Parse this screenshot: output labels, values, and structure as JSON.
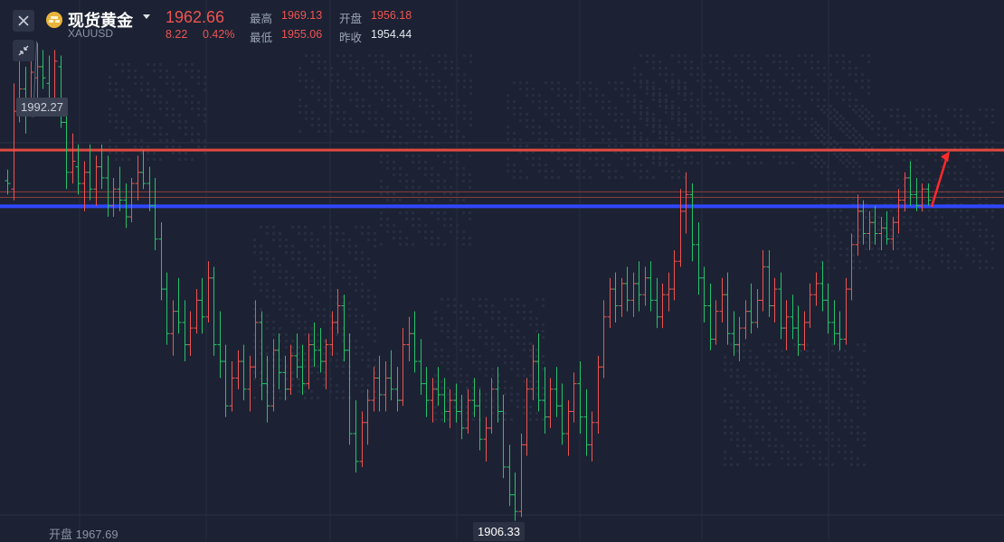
{
  "header": {
    "name": "现货黄金",
    "symbol": "XAUUSD",
    "price": "1962.66",
    "change": "8.22",
    "change_pct": "0.42%",
    "high_label": "最高",
    "high": "1969.13",
    "open_label": "开盘",
    "open": "1956.18",
    "low_label": "最低",
    "low": "1955.06",
    "prev_close_label": "昨收",
    "prev_close": "1954.44"
  },
  "annotations": {
    "max_label": "1992.27",
    "min_label": "1906.33",
    "open_marker": "开盘 1967.69"
  },
  "icons": {
    "close": "close-icon",
    "minimize": "collapse-icon",
    "coin": "gold-coin-icon"
  },
  "colors": {
    "background": "#1c2233",
    "up": "#ef5350",
    "down": "#26c26b",
    "resistance_line": "#e0493f",
    "support_line": "#2f47ff",
    "arrow": "#ff2a2a",
    "text_label": "#9aa3b5"
  },
  "chart_data": {
    "type": "bar",
    "title": "",
    "style": "ohlc-bars",
    "ylim": [
      1903,
      2000
    ],
    "grid": true,
    "horizontal_lines": [
      {
        "kind": "resistance",
        "value": 1973.0
      },
      {
        "kind": "level",
        "value": 1965.5
      },
      {
        "kind": "level",
        "value": 1964.5
      },
      {
        "kind": "support",
        "value": 1962.9
      }
    ],
    "max_marker": 1992.27,
    "min_marker": 1906.33,
    "arrow": {
      "from": 1962.8,
      "to": 1972.8
    },
    "bars": [
      [
        1967.5,
        1969.5,
        1965,
        1967
      ],
      [
        1966,
        1985,
        1964,
        1980
      ],
      [
        1980,
        1990,
        1978,
        1984
      ],
      [
        1984,
        1988,
        1976,
        1980
      ],
      [
        1980,
        1990,
        1979,
        1987
      ],
      [
        1986,
        1992.27,
        1982,
        1988
      ],
      [
        1988,
        1991,
        1984,
        1986
      ],
      [
        1985,
        1990,
        1980,
        1982
      ],
      [
        1982,
        1991,
        1981,
        1989
      ],
      [
        1988,
        1990,
        1977,
        1978
      ],
      [
        1978,
        1982,
        1966,
        1969
      ],
      [
        1969,
        1976,
        1967,
        1971
      ],
      [
        1970,
        1974,
        1965,
        1967
      ],
      [
        1967,
        1971,
        1962,
        1969
      ],
      [
        1969,
        1974,
        1964,
        1966
      ],
      [
        1966,
        1972,
        1963,
        1970
      ],
      [
        1970,
        1974,
        1966,
        1968
      ],
      [
        1968,
        1972,
        1961,
        1963
      ],
      [
        1963,
        1968,
        1961,
        1966
      ],
      [
        1966,
        1970,
        1962,
        1964
      ],
      [
        1964,
        1967,
        1959,
        1961
      ],
      [
        1961,
        1968,
        1960,
        1967
      ],
      [
        1967,
        1972,
        1964,
        1969
      ],
      [
        1969,
        1973,
        1966,
        1967
      ],
      [
        1967,
        1970,
        1962,
        1963
      ],
      [
        1963,
        1968,
        1955,
        1957
      ],
      [
        1957,
        1960,
        1946,
        1948
      ],
      [
        1948,
        1951,
        1938,
        1940
      ],
      [
        1940,
        1946,
        1936,
        1944
      ],
      [
        1944,
        1950,
        1940,
        1942
      ],
      [
        1942,
        1946,
        1935,
        1938
      ],
      [
        1938,
        1944,
        1936,
        1941
      ],
      [
        1941,
        1948,
        1940,
        1946
      ],
      [
        1946,
        1950,
        1940,
        1943
      ],
      [
        1943,
        1953,
        1942,
        1950
      ],
      [
        1950,
        1952,
        1936,
        1938
      ],
      [
        1938,
        1944,
        1932,
        1935
      ],
      [
        1935,
        1938,
        1925,
        1927
      ],
      [
        1927,
        1935,
        1926,
        1932
      ],
      [
        1932,
        1937,
        1930,
        1935
      ],
      [
        1935,
        1938,
        1928,
        1930
      ],
      [
        1930,
        1936,
        1926,
        1934
      ],
      [
        1934,
        1946,
        1932,
        1942
      ],
      [
        1942,
        1944,
        1928,
        1931
      ],
      [
        1931,
        1936,
        1924,
        1927
      ],
      [
        1927,
        1939,
        1926,
        1937
      ],
      [
        1937,
        1940,
        1930,
        1933
      ],
      [
        1933,
        1936,
        1928,
        1930
      ],
      [
        1930,
        1938,
        1929,
        1936
      ],
      [
        1936,
        1940,
        1932,
        1934
      ],
      [
        1934,
        1938,
        1929,
        1931
      ],
      [
        1931,
        1940,
        1930,
        1938
      ],
      [
        1938,
        1942,
        1934,
        1937
      ],
      [
        1937,
        1941,
        1933,
        1935
      ],
      [
        1935,
        1939,
        1930,
        1938
      ],
      [
        1938,
        1944,
        1936,
        1942
      ],
      [
        1942,
        1948,
        1940,
        1945
      ],
      [
        1945,
        1947,
        1935,
        1937
      ],
      [
        1937,
        1940,
        1920,
        1922
      ],
      [
        1922,
        1928,
        1915,
        1917
      ],
      [
        1917,
        1926,
        1916,
        1924
      ],
      [
        1924,
        1930,
        1920,
        1928
      ],
      [
        1928,
        1934,
        1926,
        1932
      ],
      [
        1932,
        1936,
        1926,
        1929
      ],
      [
        1929,
        1935,
        1926,
        1932
      ],
      [
        1932,
        1937,
        1928,
        1930
      ],
      [
        1930,
        1934,
        1926,
        1928
      ],
      [
        1928,
        1941,
        1927,
        1938
      ],
      [
        1938,
        1943,
        1935,
        1940
      ],
      [
        1940,
        1944,
        1933,
        1935
      ],
      [
        1935,
        1939,
        1929,
        1931
      ],
      [
        1931,
        1934,
        1925,
        1928
      ],
      [
        1928,
        1932,
        1924,
        1930
      ],
      [
        1930,
        1934,
        1927,
        1929
      ],
      [
        1929,
        1932,
        1924,
        1926
      ],
      [
        1926,
        1930,
        1923,
        1928
      ],
      [
        1928,
        1931,
        1924,
        1926
      ],
      [
        1926,
        1929,
        1921,
        1923
      ],
      [
        1923,
        1930,
        1922,
        1928
      ],
      [
        1928,
        1932,
        1925,
        1927
      ],
      [
        1927,
        1930,
        1919,
        1921
      ],
      [
        1921,
        1925,
        1917,
        1923
      ],
      [
        1923,
        1932,
        1922,
        1930
      ],
      [
        1930,
        1934,
        1924,
        1926
      ],
      [
        1926,
        1929,
        1914,
        1916
      ],
      [
        1916,
        1920,
        1909,
        1911
      ],
      [
        1911,
        1915,
        1906.33,
        1908
      ],
      [
        1908,
        1922,
        1907,
        1920
      ],
      [
        1920,
        1932,
        1918,
        1930
      ],
      [
        1930,
        1938,
        1928,
        1935
      ],
      [
        1935,
        1940,
        1926,
        1928
      ],
      [
        1928,
        1934,
        1922,
        1925
      ],
      [
        1925,
        1932,
        1923,
        1930
      ],
      [
        1930,
        1934,
        1925,
        1927
      ],
      [
        1927,
        1931,
        1920,
        1922
      ],
      [
        1922,
        1928,
        1918,
        1926
      ],
      [
        1926,
        1933,
        1924,
        1931
      ],
      [
        1931,
        1935,
        1922,
        1925
      ],
      [
        1925,
        1930,
        1918,
        1920
      ],
      [
        1920,
        1926,
        1917,
        1924
      ],
      [
        1924,
        1936,
        1922,
        1934
      ],
      [
        1934,
        1946,
        1932,
        1943
      ],
      [
        1943,
        1950,
        1941,
        1948
      ],
      [
        1948,
        1951,
        1942,
        1945
      ],
      [
        1945,
        1950,
        1943,
        1949
      ],
      [
        1949,
        1952,
        1944,
        1946
      ],
      [
        1946,
        1951,
        1943,
        1949
      ],
      [
        1949,
        1953,
        1944,
        1947
      ],
      [
        1947,
        1952,
        1945,
        1950
      ],
      [
        1950,
        1953,
        1944,
        1946
      ],
      [
        1946,
        1950,
        1941,
        1943
      ],
      [
        1943,
        1949,
        1941,
        1947
      ],
      [
        1947,
        1951,
        1944,
        1948
      ],
      [
        1948,
        1955,
        1946,
        1953
      ],
      [
        1953,
        1966,
        1952,
        1962
      ],
      [
        1962,
        1969,
        1958,
        1965
      ],
      [
        1965,
        1967,
        1953,
        1956
      ],
      [
        1956,
        1960,
        1947,
        1950
      ],
      [
        1950,
        1952,
        1942,
        1945
      ],
      [
        1945,
        1949,
        1937,
        1939
      ],
      [
        1939,
        1946,
        1938,
        1944
      ],
      [
        1944,
        1950,
        1942,
        1947
      ],
      [
        1947,
        1951,
        1938,
        1940
      ],
      [
        1940,
        1944,
        1936,
        1938
      ],
      [
        1938,
        1943,
        1935,
        1941
      ],
      [
        1941,
        1946,
        1939,
        1944
      ],
      [
        1944,
        1949,
        1940,
        1942
      ],
      [
        1942,
        1948,
        1941,
        1946
      ],
      [
        1946,
        1955,
        1944,
        1952
      ],
      [
        1952,
        1955,
        1943,
        1945
      ],
      [
        1945,
        1950,
        1942,
        1948
      ],
      [
        1948,
        1951,
        1939,
        1941
      ],
      [
        1941,
        1946,
        1937,
        1943
      ],
      [
        1943,
        1947,
        1939,
        1941
      ],
      [
        1941,
        1945,
        1936,
        1938
      ],
      [
        1938,
        1944,
        1937,
        1942
      ],
      [
        1942,
        1949,
        1941,
        1947
      ],
      [
        1947,
        1951,
        1945,
        1949
      ],
      [
        1949,
        1953,
        1944,
        1946
      ],
      [
        1946,
        1949,
        1940,
        1942
      ],
      [
        1942,
        1946,
        1938,
        1940
      ],
      [
        1940,
        1944,
        1937,
        1939
      ],
      [
        1939,
        1950,
        1938,
        1948
      ],
      [
        1948,
        1958,
        1946,
        1956
      ],
      [
        1956,
        1965,
        1954,
        1962
      ],
      [
        1962,
        1964,
        1956,
        1958
      ],
      [
        1958,
        1962,
        1955,
        1960
      ],
      [
        1960,
        1963,
        1956,
        1958
      ],
      [
        1958,
        1961,
        1955,
        1959
      ],
      [
        1959,
        1962,
        1956,
        1957
      ],
      [
        1957,
        1961,
        1955,
        1960
      ],
      [
        1960,
        1966,
        1958,
        1964
      ],
      [
        1964,
        1969,
        1962,
        1968
      ],
      [
        1968,
        1971,
        1963,
        1965
      ],
      [
        1965,
        1968,
        1962,
        1963
      ],
      [
        1963,
        1967,
        1962,
        1966
      ],
      [
        1966,
        1967,
        1963,
        1964
      ]
    ]
  }
}
